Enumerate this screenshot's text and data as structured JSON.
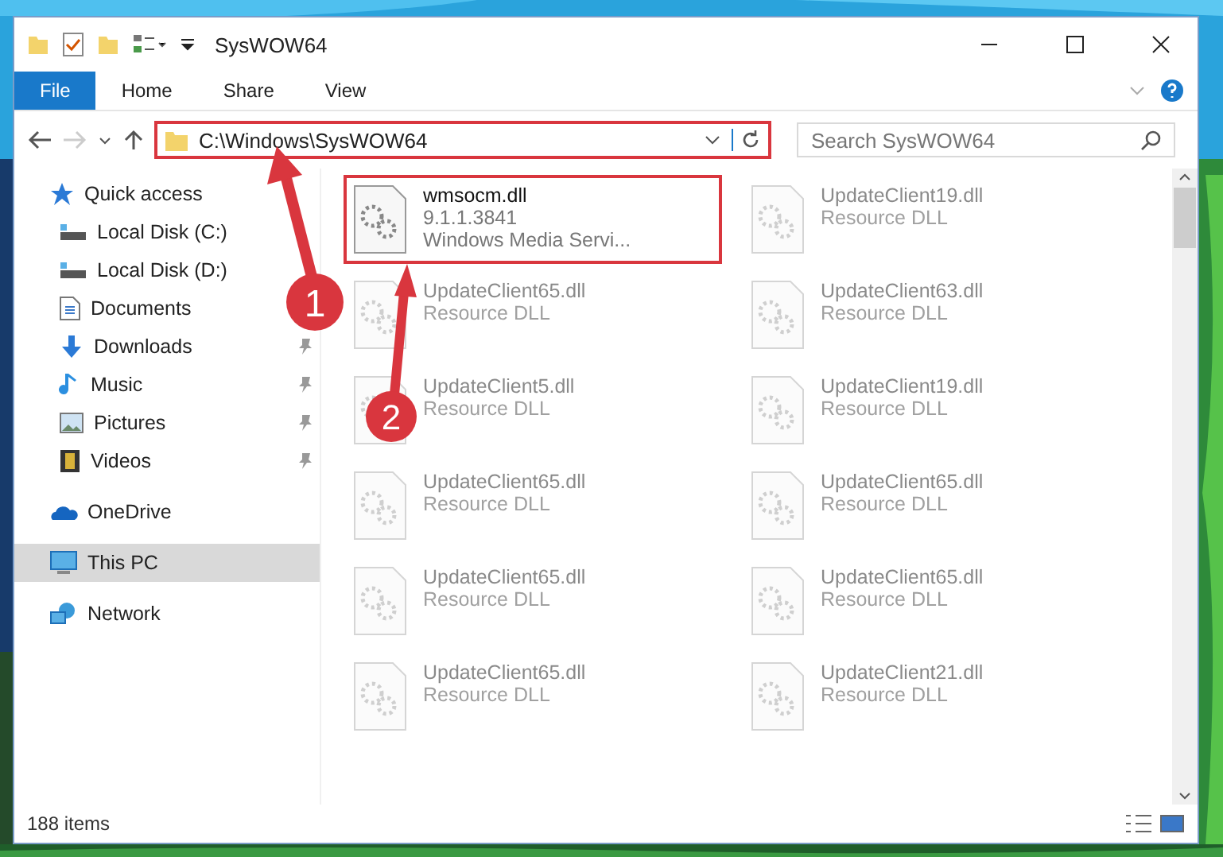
{
  "window": {
    "title": "SysWOW64"
  },
  "ribbon_tabs": [
    {
      "label": "File",
      "selected": true
    },
    {
      "label": "Home",
      "selected": false
    },
    {
      "label": "Share",
      "selected": false
    },
    {
      "label": "View",
      "selected": false
    }
  ],
  "address": {
    "path": "C:\\Windows\\SysWOW64"
  },
  "search": {
    "placeholder": "Search SysWOW64"
  },
  "sidebar": {
    "items": [
      {
        "label": "Quick access",
        "kind": "star",
        "selected": false,
        "pinned": false,
        "children": [
          {
            "label": "Local Disk (C:)",
            "kind": "disk",
            "selected": false,
            "pinned": false
          },
          {
            "label": "Local Disk (D:)",
            "kind": "disk",
            "selected": false,
            "pinned": false
          },
          {
            "label": "Documents",
            "kind": "doc",
            "selected": false,
            "pinned": false
          },
          {
            "label": "Downloads",
            "kind": "download",
            "selected": false,
            "pinned": true
          },
          {
            "label": "Music",
            "kind": "music",
            "selected": false,
            "pinned": true
          },
          {
            "label": "Pictures",
            "kind": "pictures",
            "selected": false,
            "pinned": true
          },
          {
            "label": "Videos",
            "kind": "videos",
            "selected": false,
            "pinned": true
          }
        ]
      },
      {
        "label": "OneDrive",
        "kind": "cloud",
        "selected": false,
        "pinned": false
      },
      {
        "label": "This PC",
        "kind": "pc",
        "selected": true,
        "pinned": false
      },
      {
        "label": "Network",
        "kind": "network",
        "selected": false,
        "pinned": false
      }
    ]
  },
  "files": [
    {
      "name": "wmsocm.dll",
      "line_2": "9.1.1.3841",
      "line_3": "Windows Media Servi...",
      "faded": false
    },
    {
      "name": "UpdateClient19.dll",
      "line_2": "Resource DLL",
      "faded": true
    },
    {
      "name": "UpdateClient65.dll",
      "line_2": "Resource DLL",
      "faded": true
    },
    {
      "name": "UpdateClient63.dll",
      "line_2": "Resource DLL",
      "faded": true
    },
    {
      "name": "UpdateClient5.dll",
      "line_2": "Resource DLL",
      "faded": true
    },
    {
      "name": "UpdateClient19.dll",
      "line_2": "Resource DLL",
      "faded": true
    },
    {
      "name": "UpdateClient65.dll",
      "line_2": "Resource DLL",
      "faded": true
    },
    {
      "name": "UpdateClient65.dll",
      "line_2": "Resource DLL",
      "faded": true
    },
    {
      "name": "UpdateClient65.dll",
      "line_2": "Resource DLL",
      "faded": true
    },
    {
      "name": "UpdateClient65.dll",
      "line_2": "Resource DLL",
      "faded": true
    },
    {
      "name": "UpdateClient65.dll",
      "line_2": "Resource DLL",
      "faded": true
    },
    {
      "name": "UpdateClient21.dll",
      "line_2": "Resource DLL",
      "faded": true
    }
  ],
  "status_bar": {
    "item_count": "188 items"
  },
  "annotations": [
    {
      "label": "1"
    },
    {
      "label": "2"
    }
  ]
}
